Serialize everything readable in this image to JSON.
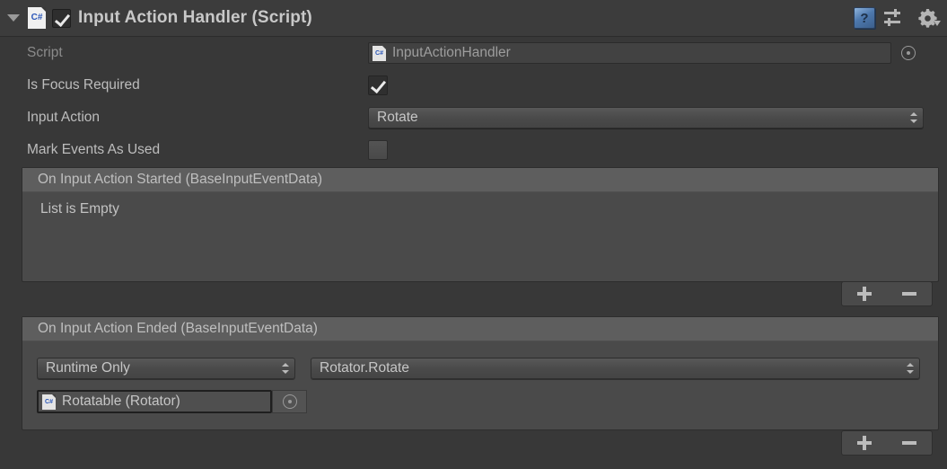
{
  "header": {
    "title": "Input Action Handler (Script)",
    "foldout_expanded": true,
    "enabled_checkbox": true,
    "script_icon_label": "C#",
    "icons": {
      "help": "help-book-icon",
      "preset": "preset-sliders-icon",
      "settings": "gear-icon"
    },
    "help_glyph": "?"
  },
  "properties": [
    {
      "label": "Script",
      "type": "object-field",
      "value": "InputActionHandler",
      "icon_label": "C#",
      "disabled": true
    },
    {
      "label": "Is Focus Required",
      "type": "toggle",
      "checked": true
    },
    {
      "label": "Input Action",
      "type": "dropdown",
      "value": "Rotate"
    },
    {
      "label": "Mark Events As Used",
      "type": "toggle",
      "checked": false
    }
  ],
  "events": [
    {
      "title": "On Input Action Started (BaseInputEventData)",
      "empty_text": "List is Empty",
      "entries": []
    },
    {
      "title": "On Input Action Ended (BaseInputEventData)",
      "empty_text": "",
      "entries": [
        {
          "call_state": "Runtime Only",
          "function": "Rotator.Rotate",
          "target_object": "Rotatable (Rotator)",
          "target_icon_label": "C#"
        }
      ]
    }
  ],
  "buttons": {
    "add_label": "+",
    "remove_label": "−"
  },
  "colors": {
    "background": "#383838",
    "header_bar": "#3c3c3c",
    "section_body": "#4a4a4a",
    "section_header": "#5e5e5e",
    "text": "#bdbdbd",
    "text_dim": "#8b8b8b",
    "field_bg": "#424242",
    "accent_blue": "#2a56b8"
  }
}
